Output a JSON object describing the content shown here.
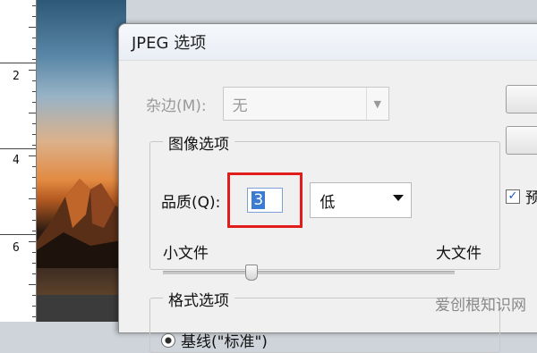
{
  "ruler": {
    "numbers": [
      "2",
      "4",
      "6"
    ]
  },
  "dialog": {
    "title": "JPEG 选项",
    "matte": {
      "label": "杂边(M):",
      "value": "无"
    },
    "image_options": {
      "group_label": "图像选项",
      "quality_label": "品质(Q):",
      "quality_value": "3",
      "quality_preset": "低",
      "small_file_label": "小文件",
      "large_file_label": "大文件",
      "slider_value_fraction": 0.3
    },
    "preview": {
      "label": "预",
      "checked": true
    },
    "format_options": {
      "group_label": "格式选项",
      "baseline_label": "基线(\"标准\")"
    }
  },
  "watermark": "爱创根知识网",
  "colors": {
    "highlight_box": "#e21b1b",
    "selection": "#3c7bd4"
  }
}
